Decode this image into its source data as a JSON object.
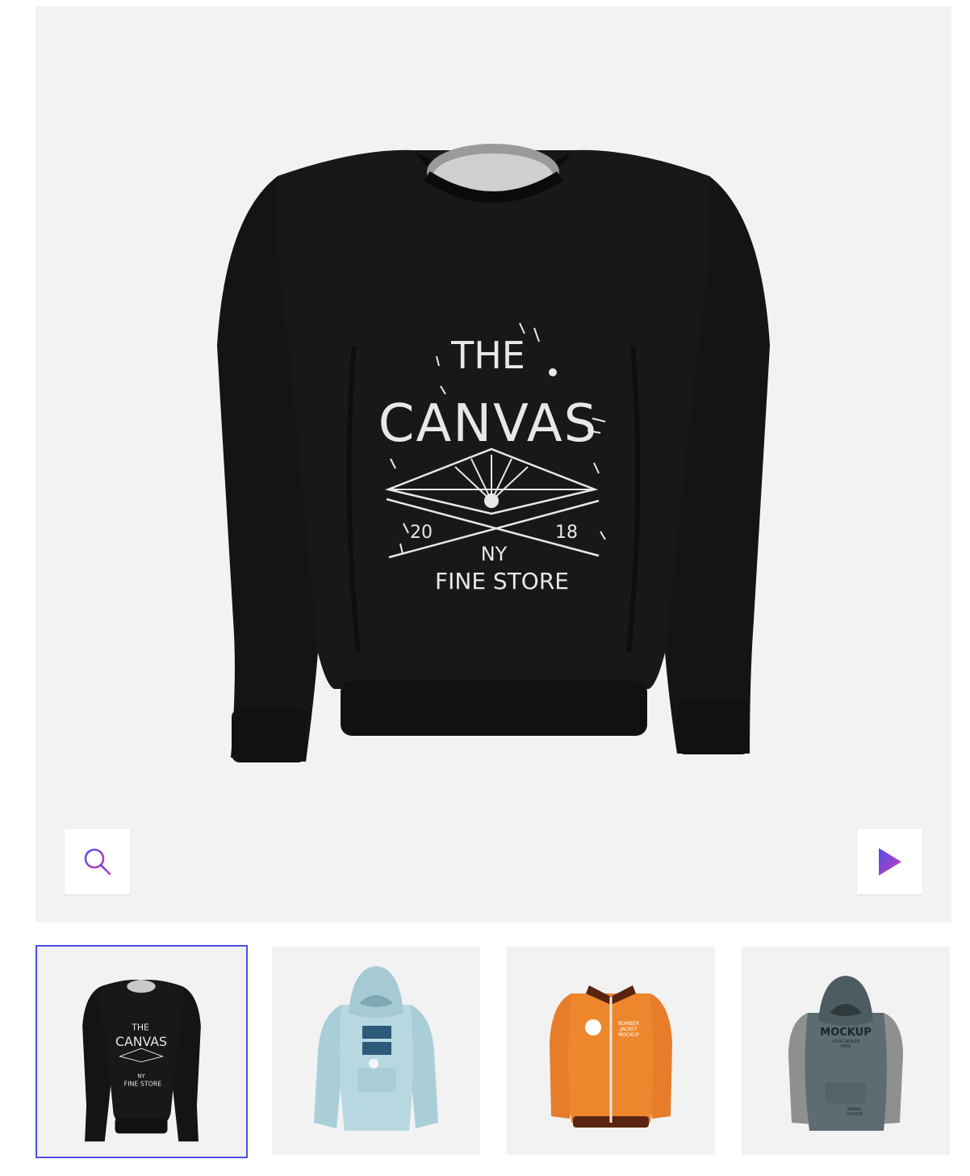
{
  "gallery": {
    "main_image": {
      "subject": "black crewneck sweatshirt",
      "print_text": {
        "line1": "THE",
        "line2": "CANVAS",
        "year_left": "20",
        "year_right": "18",
        "city": "NY",
        "store": "FINE STORE"
      }
    },
    "controls": {
      "zoom_icon": "search-icon",
      "play_icon": "play-icon"
    },
    "thumbnails": [
      {
        "subject": "black crewneck sweatshirt",
        "selected": true
      },
      {
        "subject": "light blue hoodie",
        "selected": false
      },
      {
        "subject": "orange bomber jacket",
        "selected": false,
        "print_text": [
          "BOMBER",
          "JACKET",
          "MOCKUP"
        ]
      },
      {
        "subject": "grey hoodie",
        "selected": false,
        "print_text": [
          "MOCKUP",
          "YOUR DESIGN",
          "HERE",
          "BRAND",
          "HOODIE"
        ]
      }
    ]
  },
  "colors": {
    "selected_border": "#4a4fe6",
    "accent_gradient_start": "#4b4ff0",
    "accent_gradient_end": "#d23bb0",
    "viewer_background": "#f2f2f2"
  }
}
